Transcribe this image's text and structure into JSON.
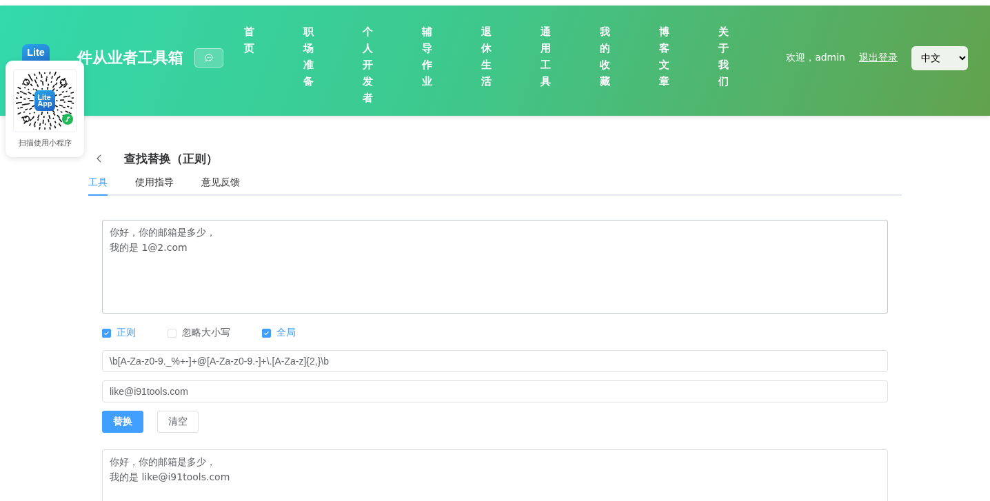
{
  "header": {
    "logo": {
      "line1": "Lite"
    },
    "site_title": "件从业者工具箱",
    "nav": [
      {
        "label": "首页"
      },
      {
        "label": "职场准备"
      },
      {
        "label": "个人开发者"
      },
      {
        "label": "辅导作业"
      },
      {
        "label": "退休生活"
      },
      {
        "label": "通用工具"
      },
      {
        "label": "我的收藏"
      },
      {
        "label": "博客文章"
      },
      {
        "label": "关于我们"
      }
    ],
    "welcome": "欢迎，admin",
    "logout": "退出登录",
    "language": "中文"
  },
  "qr_popup": {
    "logo": {
      "line1": "Lite",
      "line2": "App"
    },
    "caption": "扫描使用小程序"
  },
  "page": {
    "title": "查找替换（正则）",
    "tabs": [
      {
        "label": "工具",
        "selected": true
      },
      {
        "label": "使用指导",
        "selected": false
      },
      {
        "label": "意见反馈",
        "selected": false
      }
    ],
    "input_lines": [
      "你好，你的邮箱是多少，",
      "我的是 1@2.com"
    ],
    "options": [
      {
        "label": "正则",
        "checked": true
      },
      {
        "label": "忽略大小写",
        "checked": false
      },
      {
        "label": "全局",
        "checked": true
      }
    ],
    "pattern": "\\b[A-Za-z0-9._%+-]+@[A-Za-z0-9.-]+\\.[A-Za-z]{2,}\\b",
    "replacement": "like@i91tools.com",
    "buttons": [
      {
        "label": "替换",
        "kind": "primary"
      },
      {
        "label": "清空",
        "kind": "default"
      }
    ],
    "output_lines": [
      "你好，你的邮箱是多少，",
      "我的是 like@i91tools.com"
    ]
  }
}
